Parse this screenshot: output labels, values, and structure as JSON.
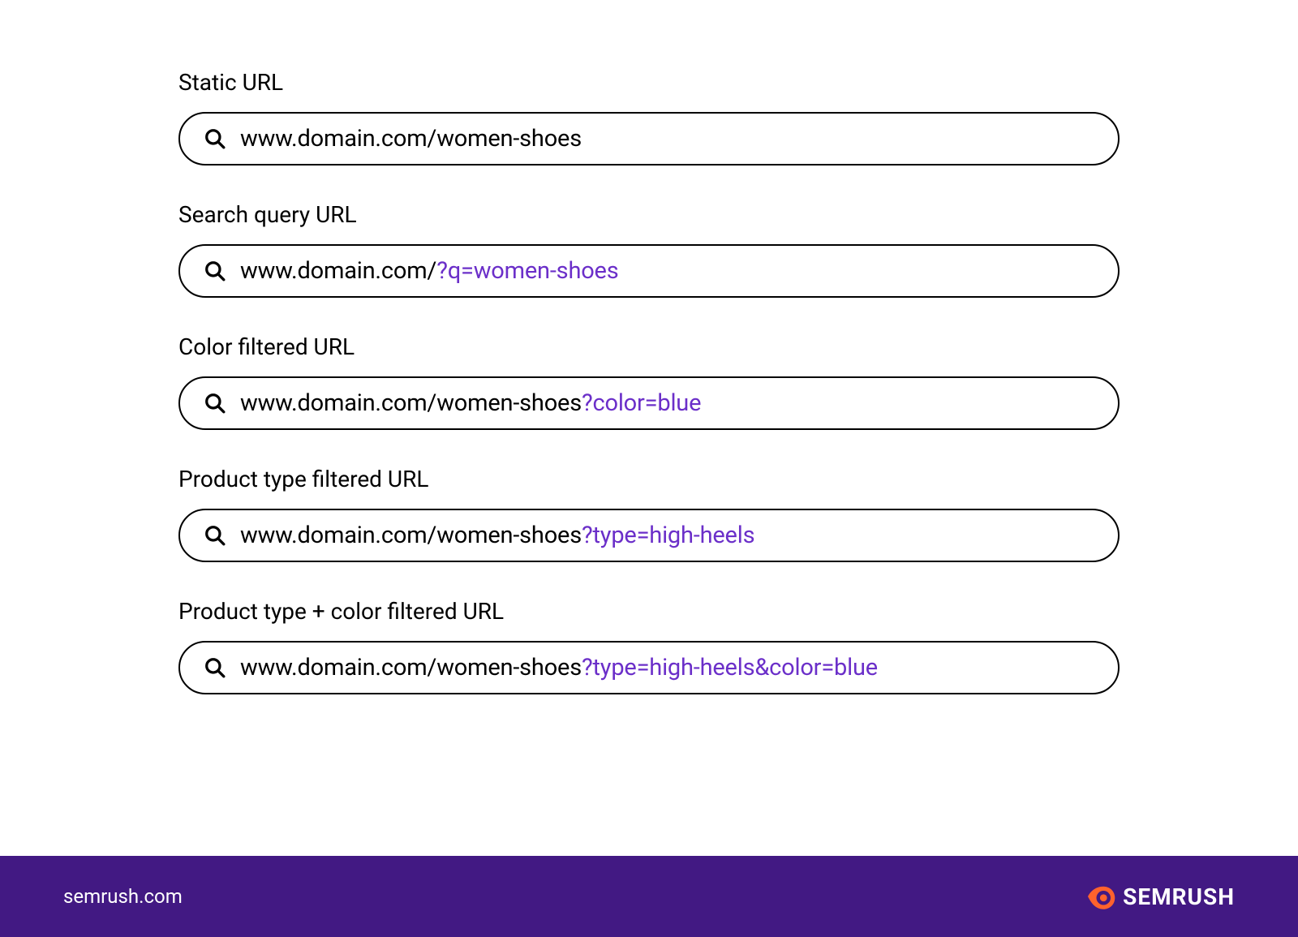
{
  "items": [
    {
      "label": "Static URL",
      "base": "www.domain.com/women-shoes",
      "query": ""
    },
    {
      "label": "Search query URL",
      "base": "www.domain.com/",
      "query": "?q=women-shoes"
    },
    {
      "label": "Color filtered URL",
      "base": "www.domain.com/women-shoes",
      "query": "?color=blue"
    },
    {
      "label": "Product type filtered URL",
      "base": "www.domain.com/women-shoes",
      "query": "?type=high-heels"
    },
    {
      "label": "Product type + color filtered URL",
      "base": "www.domain.com/women-shoes",
      "query": "?type=high-heels&color=blue"
    }
  ],
  "footer": {
    "domain": "semrush.com",
    "brand": "SEMRUSH"
  },
  "colors": {
    "query_highlight": "#6b2fc9",
    "footer_bg": "#421983",
    "logo_accent": "#ff622d"
  }
}
